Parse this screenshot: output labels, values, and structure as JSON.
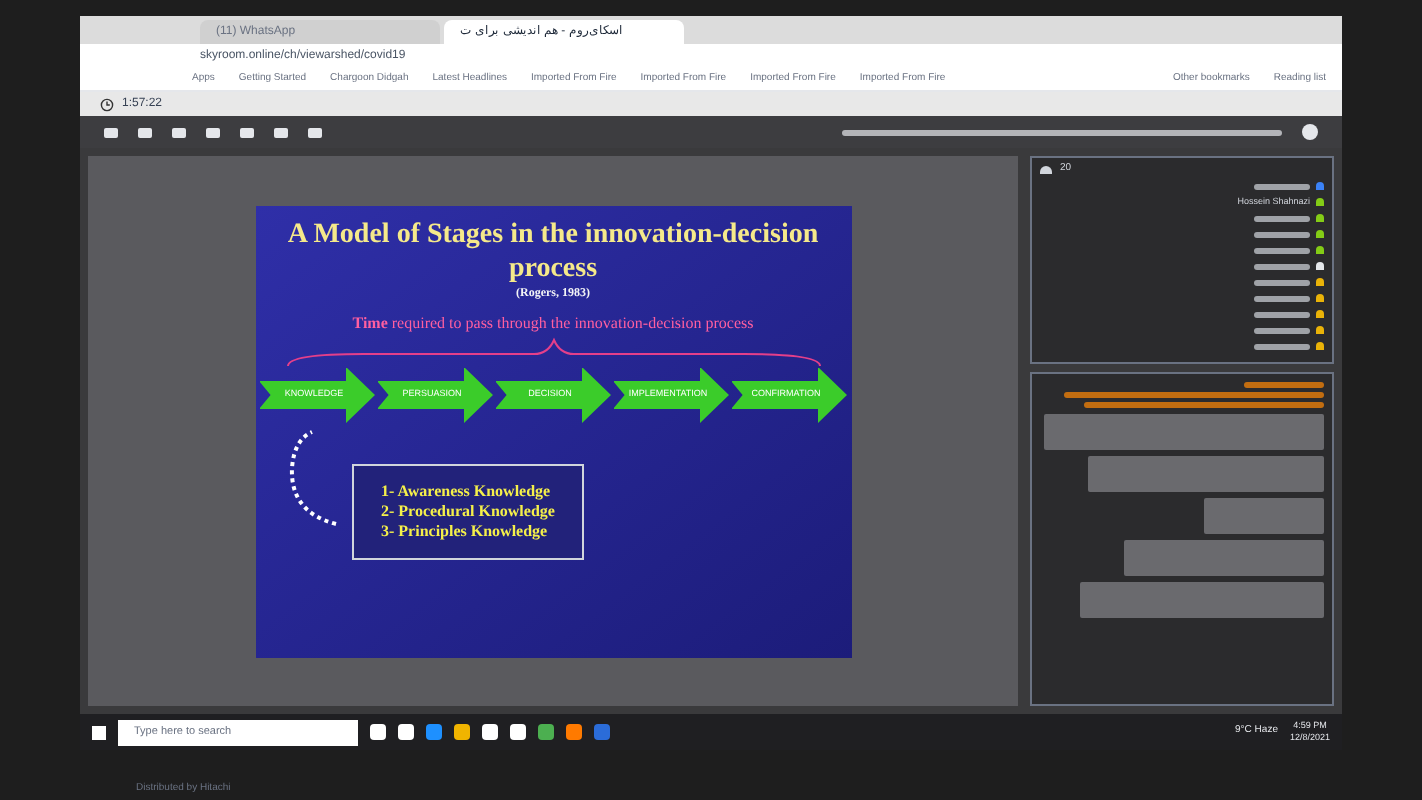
{
  "browser": {
    "tabs": [
      {
        "label": "(11) WhatsApp",
        "selected": false
      },
      {
        "label": "اسکای‌روم - هم اندیشی برای ت",
        "selected": true
      }
    ],
    "url": "skyroom.online/ch/viewarshed/covid19",
    "bookmarks": [
      "Apps",
      "Getting Started",
      "Chargoon Didgah",
      "Latest Headlines",
      "Imported From Fire",
      "Imported From Fire",
      "Imported From Fire",
      "Imported From Fire"
    ],
    "bookmarks_right": [
      "Other bookmarks",
      "Reading list"
    ]
  },
  "room": {
    "timer": "1:57:22",
    "participant_count": "20"
  },
  "slide": {
    "title": "A Model of Stages in the innovation-decision process",
    "citation": "(Rogers, 1983)",
    "time_note": "**Time** required to pass through the innovation-decision process",
    "stages": [
      "KNOWLEDGE",
      "PERSUASION",
      "DECISION",
      "IMPLEMENTATION",
      "CONFIRMATION"
    ],
    "knowledge_types": [
      "1- Awareness Knowledge",
      "2- Procedural Knowledge",
      "3- Principles Knowledge"
    ]
  },
  "users": [
    {
      "kind": "blurred",
      "color": "#3b82f6"
    },
    {
      "kind": "text",
      "name": "Hossein Shahnazi",
      "color": "#84cc16"
    },
    {
      "kind": "blurred",
      "color": "#84cc16"
    },
    {
      "kind": "blurred",
      "color": "#84cc16"
    },
    {
      "kind": "blurred",
      "color": "#84cc16"
    },
    {
      "kind": "blurred",
      "color": "#e5e7eb"
    },
    {
      "kind": "blurred",
      "color": "#eab308"
    },
    {
      "kind": "blurred",
      "color": "#eab308"
    },
    {
      "kind": "blurred",
      "color": "#eab308"
    },
    {
      "kind": "blurred",
      "color": "#eab308"
    },
    {
      "kind": "blurred",
      "color": "#eab308"
    }
  ],
  "taskbar": {
    "search_placeholder": "Type here to search",
    "weather": "9°C Haze",
    "time": "4:59 PM",
    "date": "12/8/2021"
  },
  "monitor": {
    "label": "Distributed by Hitachi"
  }
}
